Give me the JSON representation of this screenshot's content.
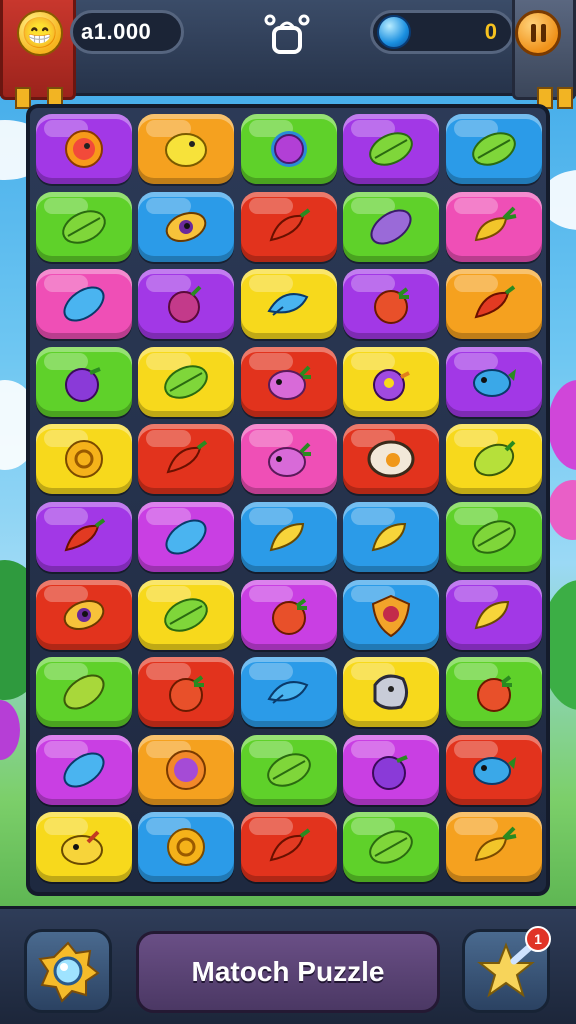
{
  "topbar": {
    "coin_value": "a1.000",
    "gem_value": "0",
    "face_glyph": "😁",
    "icons": [
      "smiley-icon",
      "bag-icon",
      "gem-icon",
      "pause-icon"
    ]
  },
  "bottombar": {
    "title": "Matoch Puzzle",
    "notification_count": "1",
    "icons": [
      "magnifier-icon",
      "star-wand-icon"
    ]
  },
  "colors": {
    "purple": "#a238e6",
    "orange": "#f5a11f",
    "green": "#5fd12a",
    "blue": "#2b9be8",
    "pink": "#ef4fb6",
    "red": "#e2331d",
    "yellow": "#f7d91c",
    "magenta": "#c93fe3"
  },
  "board": {
    "rows": 10,
    "cols": 5,
    "grid": [
      [
        [
          "purple",
          "sun"
        ],
        [
          "orange",
          "lemon"
        ],
        [
          "green",
          "berry"
        ],
        [
          "purple",
          "leaf"
        ],
        [
          "blue",
          "leaf"
        ]
      ],
      [
        [
          "green",
          "leaf"
        ],
        [
          "blue",
          "eye"
        ],
        [
          "red",
          "pepper"
        ],
        [
          "green",
          "leafp"
        ],
        [
          "pink",
          "carrot"
        ]
      ],
      [
        [
          "pink",
          "leafb"
        ],
        [
          "purple",
          "radish"
        ],
        [
          "yellow",
          "fish"
        ],
        [
          "purple",
          "tomato"
        ],
        [
          "orange",
          "pepper"
        ]
      ],
      [
        [
          "green",
          "plum"
        ],
        [
          "yellow",
          "leaf"
        ],
        [
          "red",
          "turnip"
        ],
        [
          "yellow",
          "blob"
        ],
        [
          "purple",
          "fishb"
        ]
      ],
      [
        [
          "yellow",
          "ring"
        ],
        [
          "red",
          "pepper"
        ],
        [
          "pink",
          "turnip"
        ],
        [
          "red",
          "egg"
        ],
        [
          "yellow",
          "lime"
        ]
      ],
      [
        [
          "purple",
          "pepper"
        ],
        [
          "magenta",
          "leafb"
        ],
        [
          "blue",
          "corn"
        ],
        [
          "blue",
          "corn"
        ],
        [
          "green",
          "leaf"
        ]
      ],
      [
        [
          "red",
          "eye"
        ],
        [
          "yellow",
          "leaf"
        ],
        [
          "magenta",
          "tomato"
        ],
        [
          "blue",
          "shield"
        ],
        [
          "purple",
          "corn"
        ]
      ],
      [
        [
          "green",
          "leafy"
        ],
        [
          "red",
          "tomato"
        ],
        [
          "blue",
          "fish"
        ],
        [
          "yellow",
          "rock"
        ],
        [
          "green",
          "tomato"
        ]
      ],
      [
        [
          "magenta",
          "leafb"
        ],
        [
          "orange",
          "sunp"
        ],
        [
          "green",
          "leaf"
        ],
        [
          "magenta",
          "plum"
        ],
        [
          "red",
          "fishb"
        ]
      ],
      [
        [
          "yellow",
          "bird"
        ],
        [
          "blue",
          "ring"
        ],
        [
          "red",
          "pepper"
        ],
        [
          "green",
          "leaf"
        ],
        [
          "orange",
          "carrot"
        ]
      ]
    ]
  }
}
